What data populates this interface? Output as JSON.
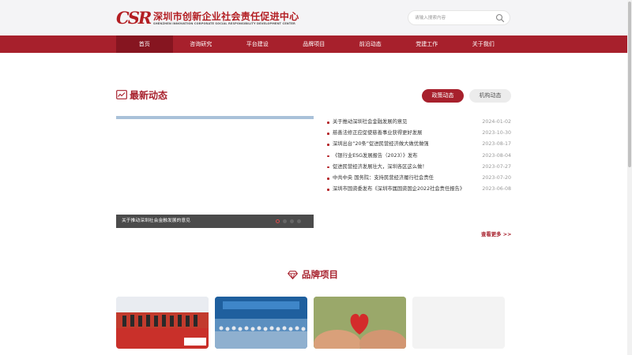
{
  "header": {
    "logo_mark": "CSR",
    "logo_cn": "深圳市创新企业社会责任促进中心",
    "logo_en": "SHENZHEN INNOVATION CORPORATE SOCIAL RESPONSIBILITY DEVELOPMENT CENTER",
    "search_placeholder": "请输入搜索内容"
  },
  "nav": {
    "items": [
      "首页",
      "咨询研究",
      "平台建设",
      "品牌项目",
      "前沿动态",
      "党建工作",
      "关于我们"
    ],
    "active_index": 0
  },
  "latest": {
    "title": "最新动态",
    "tabs": {
      "policy": "政策动态",
      "org": "机构动态"
    },
    "active_tab": "policy",
    "slider_caption": "关于推动深圳社会金融发展的意见",
    "news": [
      {
        "title": "关于推动深圳社会金融发展的意见",
        "date": "2024-01-02"
      },
      {
        "title": "慈善法修正应促使慈善事业获得更好发展",
        "date": "2023-10-30"
      },
      {
        "title": "深圳出台“20条”促进民营经济做大做优做强",
        "date": "2023-08-17"
      },
      {
        "title": "《银行业ESG发展报告（2023）》发布",
        "date": "2023-08-04"
      },
      {
        "title": "促进民营经济发展壮大，深圳各区这么做！",
        "date": "2023-07-27"
      },
      {
        "title": "中共中央 国务院：支持民营经济履行社会责任",
        "date": "2023-07-20"
      },
      {
        "title": "深圳市国资委发布《深圳市属国资国企2022社会责任报告》",
        "date": "2023-06-08"
      }
    ],
    "more": "查看更多 >>"
  },
  "brand": {
    "title": "品牌项目"
  },
  "colors": {
    "primary": "#a7202c",
    "primary_dark": "#861520",
    "text": "#333333",
    "muted": "#999999"
  }
}
